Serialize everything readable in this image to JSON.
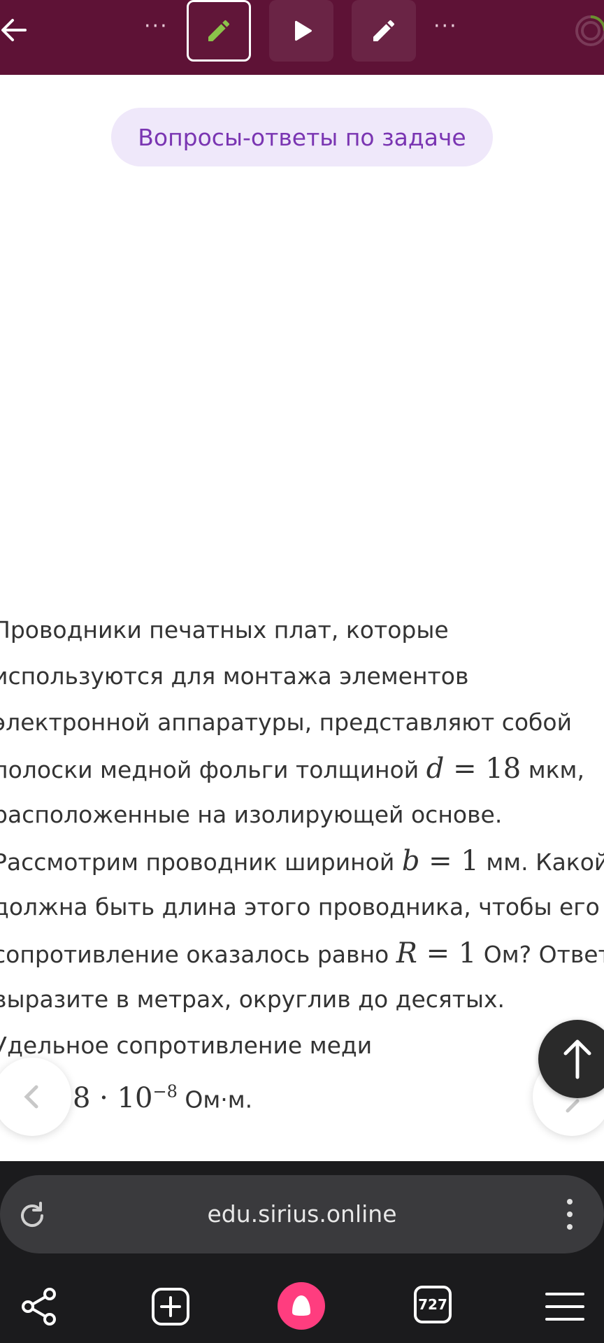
{
  "toolbar": {
    "back_icon": "arrow-left-icon",
    "buttons": [
      "pencil-icon",
      "play-icon",
      "pencil-icon"
    ],
    "accent_active": "#8bc34a"
  },
  "pill": {
    "label": "Вопросы-ответы по задаче"
  },
  "problem": {
    "l1": "Проводники печатных плат, которые",
    "l2": "используются для монтажа элементов",
    "l3": "электронной аппаратуры, представляют собой",
    "l4a": "полоски медной фольги толщиной",
    "l4b": "мкм,",
    "l5": "расположенные на изолирующей основе.",
    "l6a": "Рассмотрим проводник шириной",
    "l6b": "мм. Какой",
    "l7": "должна быть длина этого проводника, чтобы его",
    "l8a": "сопротивление оказалось равно",
    "l8b": "Ом? Ответ",
    "l9": "выразите в метрах, округлив до десятых.",
    "l10": "Удельное сопротивление меди",
    "rho_coef": "8",
    "rho_exp": "−8",
    "rho_unit": "Ом·м.",
    "d_var": "d",
    "d_val": "18",
    "b_var": "b",
    "b_val": "1",
    "r_var": "R",
    "r_val": "1"
  },
  "browser": {
    "url": "edu.sirius.online",
    "tabs_count": "727"
  }
}
